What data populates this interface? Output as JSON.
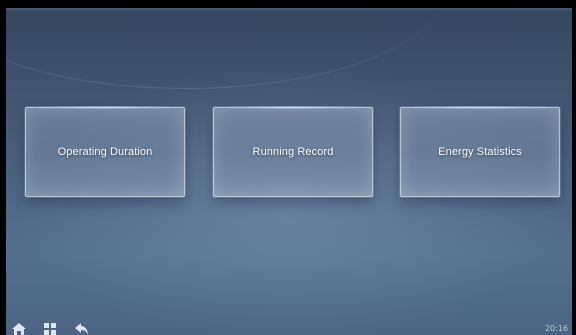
{
  "cards": [
    {
      "label": "Operating Duration"
    },
    {
      "label": "Running Record"
    },
    {
      "label": "Energy Statistics"
    }
  ],
  "bottom_bar": {
    "icons": [
      "home-icon",
      "grid-icon",
      "back-icon"
    ],
    "clock": "20:16"
  },
  "colors": {
    "background_top": "#35475f",
    "background_bottom": "#55708f",
    "card_text": "#ffffff",
    "card_glow": "#c8e6ff"
  }
}
